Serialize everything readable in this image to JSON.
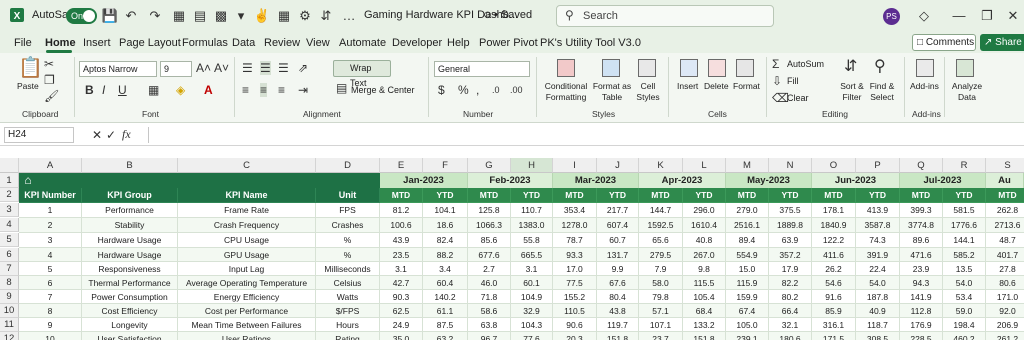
{
  "titlebar": {
    "autosave_label": "AutoSave",
    "autosave_state": "On",
    "document_title": "Gaming Hardware KPI Dashb...",
    "saved_status": "• Saved",
    "search_placeholder": "Search",
    "user_initials": "PS"
  },
  "menu": {
    "items": [
      "File",
      "Home",
      "Insert",
      "Page Layout",
      "Formulas",
      "Data",
      "Review",
      "View",
      "Automate",
      "Developer",
      "Help",
      "Power Pivot",
      "PK's Utility Tool V3.0"
    ],
    "comments": "Comments",
    "share": "Share"
  },
  "ribbon": {
    "clipboard": {
      "paste": "Paste",
      "group": "Clipboard"
    },
    "font": {
      "name": "Aptos Narrow",
      "size": "9",
      "group": "Font"
    },
    "alignment": {
      "wrap_text": "Wrap Text",
      "merge_center": "Merge & Center",
      "group": "Alignment"
    },
    "number": {
      "format": "General",
      "group": "Number"
    },
    "styles": {
      "conditional": "Conditional Formatting",
      "format_table": "Format as Table",
      "cell_styles": "Cell Styles",
      "group": "Styles"
    },
    "cells": {
      "insert": "Insert",
      "delete": "Delete",
      "format": "Format",
      "group": "Cells"
    },
    "editing": {
      "autosum": "AutoSum",
      "fill": "Fill",
      "clear": "Clear",
      "sort_filter": "Sort & Filter",
      "find_select": "Find & Select",
      "group": "Editing"
    },
    "addins": {
      "addins": "Add-ins",
      "group": "Add-ins"
    },
    "analyze": {
      "label": "Analyze Data"
    }
  },
  "formula_bar": {
    "name_box": "H24",
    "fx": "fx",
    "content": ""
  },
  "sheet": {
    "columns": [
      "A",
      "B",
      "C",
      "D",
      "E",
      "F",
      "G",
      "H",
      "I",
      "J",
      "K",
      "L",
      "M",
      "N",
      "O",
      "P",
      "Q",
      "R",
      "S"
    ],
    "selected_column": "H",
    "rows": [
      "1",
      "2",
      "3",
      "4",
      "5",
      "6",
      "7",
      "8",
      "9",
      "10",
      "11",
      "12"
    ],
    "headers": [
      "KPI Number",
      "KPI Group",
      "KPI Name",
      "Unit"
    ],
    "months": [
      "Jan-2023",
      "Feb-2023",
      "Mar-2023",
      "Apr-2023",
      "May-2023",
      "Jun-2023",
      "Jul-2023",
      "Au"
    ],
    "mtd": "MTD",
    "ytd": "YTD",
    "kpis": [
      {
        "num": "1",
        "group": "Performance",
        "name": "Frame Rate",
        "unit": "FPS",
        "vals": [
          "81.2",
          "104.1",
          "125.8",
          "110.7",
          "353.4",
          "217.7",
          "144.7",
          "296.0",
          "279.0",
          "375.5",
          "178.1",
          "413.9",
          "399.3",
          "581.5",
          "262.8"
        ]
      },
      {
        "num": "2",
        "group": "Stability",
        "name": "Crash Frequency",
        "unit": "Crashes",
        "vals": [
          "100.6",
          "18.6",
          "1066.3",
          "1383.0",
          "1278.0",
          "607.4",
          "1592.5",
          "1610.4",
          "2516.1",
          "1889.8",
          "1840.9",
          "3587.8",
          "3774.8",
          "1776.6",
          "2713.6"
        ]
      },
      {
        "num": "3",
        "group": "Hardware Usage",
        "name": "CPU Usage",
        "unit": "%",
        "vals": [
          "43.9",
          "82.4",
          "85.6",
          "55.8",
          "78.7",
          "60.7",
          "65.6",
          "40.8",
          "89.4",
          "63.9",
          "122.2",
          "74.3",
          "89.6",
          "144.1",
          "48.7"
        ]
      },
      {
        "num": "4",
        "group": "Hardware Usage",
        "name": "GPU Usage",
        "unit": "%",
        "vals": [
          "23.5",
          "88.2",
          "677.6",
          "665.5",
          "93.3",
          "131.7",
          "279.5",
          "267.0",
          "554.9",
          "357.2",
          "411.6",
          "391.9",
          "471.6",
          "585.2",
          "401.7"
        ]
      },
      {
        "num": "5",
        "group": "Responsiveness",
        "name": "Input Lag",
        "unit": "Milliseconds",
        "vals": [
          "3.1",
          "3.4",
          "2.7",
          "3.1",
          "17.0",
          "9.9",
          "7.9",
          "9.8",
          "15.0",
          "17.9",
          "26.2",
          "22.4",
          "23.9",
          "13.5",
          "27.8"
        ]
      },
      {
        "num": "6",
        "group": "Thermal Performance",
        "name": "Average Operating Temperature",
        "unit": "Celsius",
        "vals": [
          "42.7",
          "60.4",
          "46.0",
          "60.1",
          "77.5",
          "67.6",
          "58.0",
          "115.5",
          "115.9",
          "82.2",
          "54.6",
          "54.0",
          "94.3",
          "54.0",
          "80.6"
        ]
      },
      {
        "num": "7",
        "group": "Power Consumption",
        "name": "Energy Efficiency",
        "unit": "Watts",
        "vals": [
          "90.3",
          "140.2",
          "71.8",
          "104.9",
          "155.2",
          "80.4",
          "79.8",
          "105.4",
          "159.9",
          "80.2",
          "91.6",
          "187.8",
          "141.9",
          "53.4",
          "171.0"
        ]
      },
      {
        "num": "8",
        "group": "Cost Efficiency",
        "name": "Cost per Performance",
        "unit": "$/FPS",
        "vals": [
          "62.5",
          "61.1",
          "58.6",
          "32.9",
          "110.5",
          "43.8",
          "57.1",
          "68.4",
          "67.4",
          "66.4",
          "85.9",
          "40.9",
          "112.8",
          "59.0",
          "92.0"
        ]
      },
      {
        "num": "9",
        "group": "Longevity",
        "name": "Mean Time Between Failures",
        "unit": "Hours",
        "vals": [
          "24.9",
          "87.5",
          "63.8",
          "104.3",
          "90.6",
          "119.7",
          "107.1",
          "133.2",
          "105.0",
          "32.1",
          "316.1",
          "118.7",
          "176.9",
          "198.4",
          "206.9"
        ]
      },
      {
        "num": "10",
        "group": "User Satisfaction",
        "name": "User Ratings",
        "unit": "Rating",
        "vals": [
          "35.0",
          "63.2",
          "96.7",
          "77.6",
          "20.3",
          "151.8",
          "23.7",
          "151.8",
          "239.1",
          "180.6",
          "171.5",
          "308.5",
          "228.5",
          "460.2",
          "261.2"
        ]
      }
    ]
  }
}
